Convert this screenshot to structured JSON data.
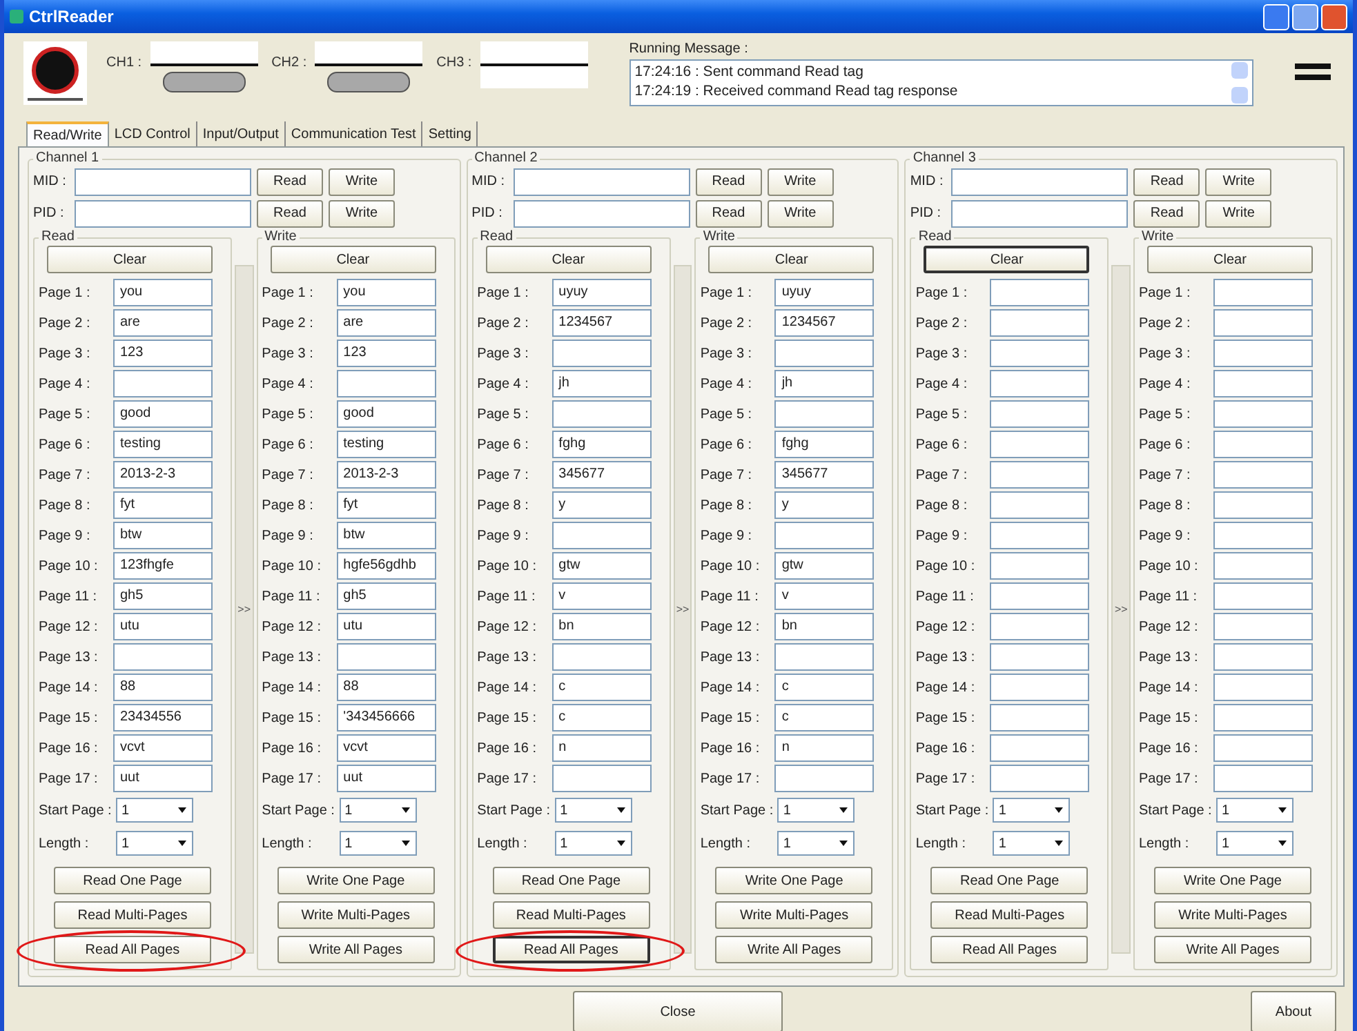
{
  "window": {
    "title": "CtrlReader"
  },
  "indicators": [
    {
      "label": "CH1 :",
      "lamp": true
    },
    {
      "label": "CH2 :",
      "lamp": true
    },
    {
      "label": "CH3 :",
      "lamp": false
    }
  ],
  "running_message": {
    "label": "Running Message :",
    "lines": [
      "17:24:16 :  Sent command Read tag",
      "17:24:19 :  Received command Read tag response"
    ]
  },
  "tabs": [
    {
      "label": "Read/Write",
      "selected": true
    },
    {
      "label": "LCD Control",
      "selected": false
    },
    {
      "label": "Input/Output",
      "selected": false
    },
    {
      "label": "Communication Test",
      "selected": false
    },
    {
      "label": "Setting",
      "selected": false
    }
  ],
  "channels": [
    {
      "title": "Channel 1",
      "id_rows": [
        {
          "label": "MID :",
          "buttons": [
            "Read",
            "Write"
          ]
        },
        {
          "label": "PID :",
          "buttons": [
            "Read",
            "Write"
          ]
        }
      ],
      "transfer": ">>",
      "panels": [
        {
          "title": "Read",
          "clear": {
            "label": "Clear",
            "focused": false
          },
          "pages": [
            {
              "label": "Page 1 :",
              "value": "you"
            },
            {
              "label": "Page 2 :",
              "value": "are"
            },
            {
              "label": "Page 3 :",
              "value": "123"
            },
            {
              "label": "Page 4 :"
            },
            {
              "label": "Page 5 :",
              "value": "good"
            },
            {
              "label": "Page 6 :",
              "value": "testing"
            },
            {
              "label": "Page 7 :",
              "value": "2013-2-3"
            },
            {
              "label": "Page 8 :",
              "value": "fyt"
            },
            {
              "label": "Page 9 :",
              "value": "btw"
            },
            {
              "label": "Page 10 :",
              "value": "123fhgfe"
            },
            {
              "label": "Page 11 :",
              "value": "gh5"
            },
            {
              "label": "Page 12 :",
              "value": "utu"
            },
            {
              "label": "Page 13 :"
            },
            {
              "label": "Page 14 :",
              "value": "88"
            },
            {
              "label": "Page 15 :",
              "value": "23434556"
            },
            {
              "label": "Page 16 :",
              "value": "vcvt"
            },
            {
              "label": "Page 17 :",
              "value": "uut"
            }
          ],
          "start_label": "Start Page :",
          "start_value": "1",
          "length_label": "Length :",
          "length_value": "1",
          "actions": [
            {
              "label": "Read One Page",
              "focused": false,
              "circled": false
            },
            {
              "label": "Read Multi-Pages",
              "focused": false,
              "circled": false
            },
            {
              "label": "Read All Pages",
              "focused": false,
              "circled": true
            }
          ]
        },
        {
          "title": "Write",
          "clear": {
            "label": "Clear",
            "focused": false
          },
          "pages": [
            {
              "label": "Page 1 :",
              "value": "you"
            },
            {
              "label": "Page 2 :",
              "value": "are"
            },
            {
              "label": "Page 3 :",
              "value": "123"
            },
            {
              "label": "Page 4 :"
            },
            {
              "label": "Page 5 :",
              "value": "good"
            },
            {
              "label": "Page 6 :",
              "value": "testing"
            },
            {
              "label": "Page 7 :",
              "value": "2013-2-3"
            },
            {
              "label": "Page 8 :",
              "value": "fyt"
            },
            {
              "label": "Page 9 :",
              "value": "btw"
            },
            {
              "label": "Page 10 :",
              "value": "hgfe56gdhb"
            },
            {
              "label": "Page 11 :",
              "value": "gh5"
            },
            {
              "label": "Page 12 :",
              "value": "utu"
            },
            {
              "label": "Page 13 :"
            },
            {
              "label": "Page 14 :",
              "value": "88"
            },
            {
              "label": "Page 15 :",
              "value": "'343456666"
            },
            {
              "label": "Page 16 :",
              "value": "vcvt"
            },
            {
              "label": "Page 17 :",
              "value": "uut"
            }
          ],
          "start_label": "Start Page :",
          "start_value": "1",
          "length_label": "Length :",
          "length_value": "1",
          "actions": [
            {
              "label": "Write One Page",
              "focused": false,
              "circled": false
            },
            {
              "label": "Write Multi-Pages",
              "focused": false,
              "circled": false
            },
            {
              "label": "Write All Pages",
              "focused": false,
              "circled": false
            }
          ]
        }
      ]
    },
    {
      "title": "Channel 2",
      "id_rows": [
        {
          "label": "MID :",
          "buttons": [
            "Read",
            "Write"
          ]
        },
        {
          "label": "PID :",
          "buttons": [
            "Read",
            "Write"
          ]
        }
      ],
      "transfer": ">>",
      "panels": [
        {
          "title": "Read",
          "clear": {
            "label": "Clear",
            "focused": false
          },
          "pages": [
            {
              "label": "Page 1 :",
              "value": "uyuy"
            },
            {
              "label": "Page 2 :",
              "value": "1234567"
            },
            {
              "label": "Page 3 :"
            },
            {
              "label": "Page 4 :",
              "value": "jh"
            },
            {
              "label": "Page 5 :"
            },
            {
              "label": "Page 6 :",
              "value": "fghg"
            },
            {
              "label": "Page 7 :",
              "value": "345677"
            },
            {
              "label": "Page 8 :",
              "value": "y"
            },
            {
              "label": "Page 9 :"
            },
            {
              "label": "Page 10 :",
              "value": "gtw"
            },
            {
              "label": "Page 11 :",
              "value": "v"
            },
            {
              "label": "Page 12 :",
              "value": "bn"
            },
            {
              "label": "Page 13 :"
            },
            {
              "label": "Page 14 :",
              "value": "c"
            },
            {
              "label": "Page 15 :",
              "value": "c"
            },
            {
              "label": "Page 16 :",
              "value": "n"
            },
            {
              "label": "Page 17 :"
            }
          ],
          "start_label": "Start Page :",
          "start_value": "1",
          "length_label": "Length :",
          "length_value": "1",
          "actions": [
            {
              "label": "Read One Page",
              "focused": false,
              "circled": false
            },
            {
              "label": "Read Multi-Pages",
              "focused": false,
              "circled": false
            },
            {
              "label": "Read All Pages",
              "focused": true,
              "circled": true
            }
          ]
        },
        {
          "title": "Write",
          "clear": {
            "label": "Clear",
            "focused": false
          },
          "pages": [
            {
              "label": "Page 1 :",
              "value": "uyuy"
            },
            {
              "label": "Page 2 :",
              "value": "1234567"
            },
            {
              "label": "Page 3 :"
            },
            {
              "label": "Page 4 :",
              "value": "jh"
            },
            {
              "label": "Page 5 :"
            },
            {
              "label": "Page 6 :",
              "value": "fghg"
            },
            {
              "label": "Page 7 :",
              "value": "345677"
            },
            {
              "label": "Page 8 :",
              "value": "y"
            },
            {
              "label": "Page 9 :"
            },
            {
              "label": "Page 10 :",
              "value": "gtw"
            },
            {
              "label": "Page 11 :",
              "value": "v"
            },
            {
              "label": "Page 12 :",
              "value": "bn"
            },
            {
              "label": "Page 13 :"
            },
            {
              "label": "Page 14 :",
              "value": "c"
            },
            {
              "label": "Page 15 :",
              "value": "c"
            },
            {
              "label": "Page 16 :",
              "value": "n"
            },
            {
              "label": "Page 17 :"
            }
          ],
          "start_label": "Start Page :",
          "start_value": "1",
          "length_label": "Length :",
          "length_value": "1",
          "actions": [
            {
              "label": "Write One Page",
              "focused": false,
              "circled": false
            },
            {
              "label": "Write Multi-Pages",
              "focused": false,
              "circled": false
            },
            {
              "label": "Write All Pages",
              "focused": false,
              "circled": false
            }
          ]
        }
      ]
    },
    {
      "title": "Channel 3",
      "id_rows": [
        {
          "label": "MID :",
          "buttons": [
            "Read",
            "Write"
          ]
        },
        {
          "label": "PID :",
          "buttons": [
            "Read",
            "Write"
          ]
        }
      ],
      "transfer": ">>",
      "panels": [
        {
          "title": "Read",
          "clear": {
            "label": "Clear",
            "focused": true
          },
          "pages": [
            {
              "label": "Page 1 :"
            },
            {
              "label": "Page 2 :"
            },
            {
              "label": "Page 3 :"
            },
            {
              "label": "Page 4 :"
            },
            {
              "label": "Page 5 :"
            },
            {
              "label": "Page 6 :"
            },
            {
              "label": "Page 7 :"
            },
            {
              "label": "Page 8 :"
            },
            {
              "label": "Page 9 :"
            },
            {
              "label": "Page 10 :"
            },
            {
              "label": "Page 11 :"
            },
            {
              "label": "Page 12 :"
            },
            {
              "label": "Page 13 :"
            },
            {
              "label": "Page 14 :"
            },
            {
              "label": "Page 15 :"
            },
            {
              "label": "Page 16 :"
            },
            {
              "label": "Page 17 :"
            }
          ],
          "start_label": "Start Page :",
          "start_value": "1",
          "length_label": "Length :",
          "length_value": "1",
          "actions": [
            {
              "label": "Read One Page",
              "focused": false,
              "circled": false
            },
            {
              "label": "Read Multi-Pages",
              "focused": false,
              "circled": false
            },
            {
              "label": "Read All Pages",
              "focused": false,
              "circled": false
            }
          ]
        },
        {
          "title": "Write",
          "clear": {
            "label": "Clear",
            "focused": false
          },
          "pages": [
            {
              "label": "Page 1 :"
            },
            {
              "label": "Page 2 :"
            },
            {
              "label": "Page 3 :"
            },
            {
              "label": "Page 4 :"
            },
            {
              "label": "Page 5 :"
            },
            {
              "label": "Page 6 :"
            },
            {
              "label": "Page 7 :"
            },
            {
              "label": "Page 8 :"
            },
            {
              "label": "Page 9 :"
            },
            {
              "label": "Page 10 :"
            },
            {
              "label": "Page 11 :"
            },
            {
              "label": "Page 12 :"
            },
            {
              "label": "Page 13 :"
            },
            {
              "label": "Page 14 :"
            },
            {
              "label": "Page 15 :"
            },
            {
              "label": "Page 16 :"
            },
            {
              "label": "Page 17 :"
            }
          ],
          "start_label": "Start Page :",
          "start_value": "1",
          "length_label": "Length :",
          "length_value": "1",
          "actions": [
            {
              "label": "Write One Page",
              "focused": false,
              "circled": false
            },
            {
              "label": "Write Multi-Pages",
              "focused": false,
              "circled": false
            },
            {
              "label": "Write All Pages",
              "focused": false,
              "circled": false
            }
          ]
        }
      ]
    }
  ],
  "footer": {
    "buttons": [
      "Close",
      "About"
    ]
  }
}
